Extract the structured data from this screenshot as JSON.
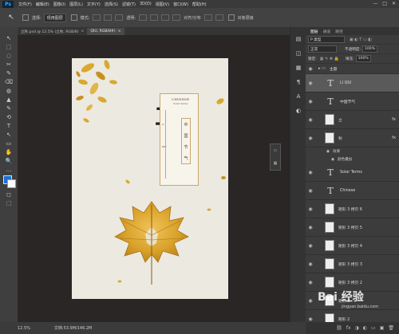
{
  "app": {
    "logo": "Ps"
  },
  "menu": [
    "文件(F)",
    "编辑(E)",
    "图像(I)",
    "图层(L)",
    "文字(Y)",
    "选择(S)",
    "滤镜(T)",
    "3D(D)",
    "视图(V)",
    "窗口(W)",
    "帮助(H)"
  ],
  "window_controls": [
    "—",
    "□",
    "✕"
  ],
  "options": {
    "auto_select_label": "选择:",
    "auto_select_value": "现用图层",
    "transform_label": "模式:",
    "opacity_label": "透明:",
    "snap_label": "对齐/分布",
    "extra_label": "对象层级"
  },
  "tabs": [
    {
      "label": "立秋.psd @ 12.5% (立秋, RGB/8)",
      "close": "×",
      "active": false
    },
    {
      "label": "QIU, RGB/8#)",
      "close": "×",
      "active": true
    }
  ],
  "toolbar_icons": [
    "↖",
    "⬚",
    "◌",
    "✂",
    "✎",
    "⌫",
    "◍",
    "▲",
    "✎",
    "⟲",
    "T",
    "↖",
    "▭",
    "✋",
    "🔍",
    "…",
    "◼",
    "◻",
    "⬚"
  ],
  "artwork": {
    "title_chars": [
      "立",
      "秋"
    ],
    "card_en": "CHINESE",
    "card_en2": "Solar Terms",
    "card_vertical": [
      "中",
      "国",
      "节",
      "气"
    ],
    "card_side": "Li",
    "card_side2": "QIU"
  },
  "dock_icons": [
    "▤",
    "◫",
    "▦",
    "¶",
    "A",
    "◐"
  ],
  "panel": {
    "tabs": [
      "图层",
      "通道",
      "路径"
    ],
    "kind_label": "P 类型",
    "blend_mode": "正常",
    "opacity_label": "不透明度:",
    "opacity_value": "100%",
    "lock_label": "锁定:",
    "fill_label": "填充:",
    "fill_value": "100%",
    "layers": [
      {
        "name": "主题",
        "kind": "group",
        "fx": "",
        "selected": false
      },
      {
        "name": "LI  QIU",
        "kind": "text",
        "fx": "",
        "selected": true
      },
      {
        "name": "中国节气",
        "kind": "text",
        "fx": "",
        "selected": false
      },
      {
        "name": "立",
        "kind": "image",
        "fx": "fx",
        "selected": false
      },
      {
        "name": "秋",
        "kind": "image",
        "fx": "fx",
        "selected": false
      },
      {
        "name": "Solar Terms",
        "kind": "text",
        "fx": "",
        "selected": false
      },
      {
        "name": "Chinese",
        "kind": "text",
        "fx": "",
        "selected": false
      },
      {
        "name": "矩形 3 拷贝 6",
        "kind": "image",
        "fx": "",
        "selected": false
      },
      {
        "name": "矩形 3 拷贝 5",
        "kind": "image",
        "fx": "",
        "selected": false
      },
      {
        "name": "矩形 3 拷贝 4",
        "kind": "image",
        "fx": "",
        "selected": false
      },
      {
        "name": "矩形 3 拷贝 3",
        "kind": "image",
        "fx": "",
        "selected": false
      },
      {
        "name": "矩形 3 拷贝 2",
        "kind": "image",
        "fx": "",
        "selected": false
      },
      {
        "name": "矩形 3",
        "kind": "image",
        "fx": "",
        "selected": false
      },
      {
        "name": "矩形 2",
        "kind": "image",
        "fx": "",
        "selected": false
      },
      {
        "name": "矩形 1",
        "kind": "image",
        "fx": "",
        "selected": false
      }
    ],
    "effects_label": "效果",
    "overlay_label": "颜色叠加"
  },
  "status": {
    "zoom": "12.5%",
    "doc": "文档:53.9M/146.2M"
  },
  "watermark": {
    "text": "Bai 经验",
    "sub": "jingyan.baidu.com"
  },
  "colors": {
    "accent": "#31a8ff",
    "foreground_swatch": "#1e6fd0",
    "background_swatch": "#ffffff",
    "leaf": "#d9a82e",
    "ink": "#2b1b12"
  }
}
